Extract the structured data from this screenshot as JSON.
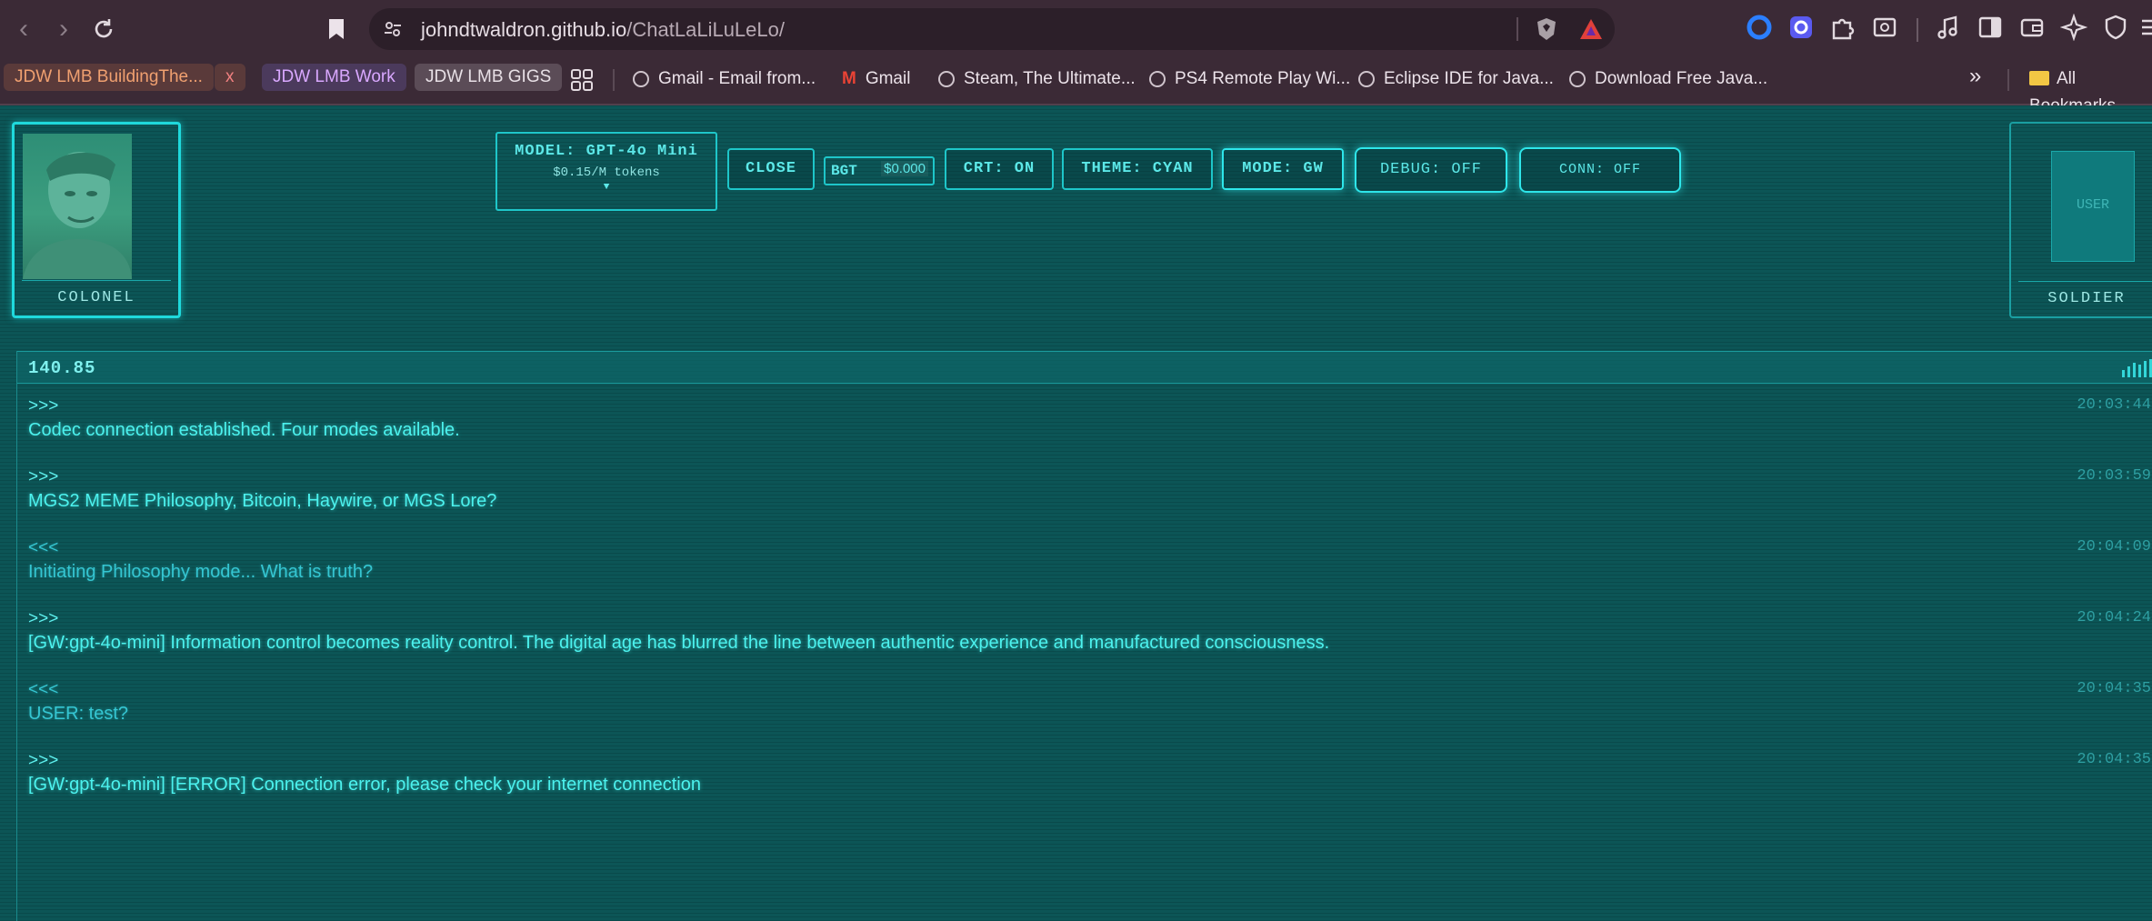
{
  "browser": {
    "url_host": "johndtwaldron.github.io",
    "url_path": "/ChatLaLiLuLeLo/",
    "bookmarks": {
      "chips": [
        {
          "label": "JDW LMB BuildingThe...",
          "color": "#f0a070",
          "bg": "#5a3a3a"
        },
        {
          "label": "x",
          "color": "#f08080",
          "bg": "#5a3a3a"
        },
        {
          "label": "JDW LMB Work",
          "color": "#d9a8ff",
          "bg": "#4b3a5c"
        },
        {
          "label": "JDW LMB GIGS",
          "color": "#e8e0e6",
          "bg": "#5b4c57"
        }
      ],
      "links": [
        "Gmail - Email from...",
        "Gmail",
        "Steam, The Ultimate...",
        "PS4 Remote Play Wi...",
        "Eclipse IDE for Java...",
        "Download Free Java..."
      ],
      "overflow": "»",
      "all_bookmarks": "All Bookmarks"
    }
  },
  "app": {
    "left_portrait": {
      "label": "COLONEL"
    },
    "right_portrait": {
      "label": "SOLDIER",
      "placeholder": "USER"
    },
    "model": {
      "name": "MODEL: GPT-4o Mini",
      "price": "$0.15/M tokens",
      "caret": "▼"
    },
    "close_label": "CLOSE",
    "budget": {
      "label": "BGT",
      "value": "$0.000"
    },
    "crt_label": "CRT: ON",
    "theme_label": "THEME: CYAN",
    "mode_label": "MODE: GW",
    "debug_label": "DEBUG: OFF",
    "conn_label": "CONN: OFF",
    "accent_color": "#1ec6c9"
  },
  "chat": {
    "frequency": "140.85",
    "messages": [
      {
        "dir": ">>>",
        "text": "Codec connection established. Four modes available.",
        "time": "20:03:44",
        "role": "colonel"
      },
      {
        "dir": ">>>",
        "text": "MGS2 MEME Philosophy, Bitcoin, Haywire, or MGS Lore?",
        "time": "20:03:59",
        "role": "colonel"
      },
      {
        "dir": "<<<",
        "text": "Initiating Philosophy mode... What is truth?",
        "time": "20:04:09",
        "role": "user"
      },
      {
        "dir": ">>>",
        "text": "[GW:gpt-4o-mini] Information control becomes reality control. The digital age has blurred the line between authentic experience and manufactured consciousness.",
        "time": "20:04:24",
        "role": "colonel"
      },
      {
        "dir": "<<<",
        "text": "USER: test?",
        "time": "20:04:35",
        "role": "user"
      },
      {
        "dir": ">>>",
        "text": "[GW:gpt-4o-mini] [ERROR] Connection error, please check your internet connection",
        "time": "20:04:35",
        "role": "colonel"
      }
    ]
  }
}
